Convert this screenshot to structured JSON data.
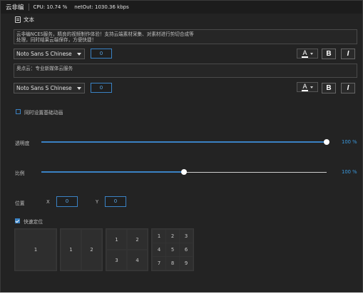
{
  "topbar": {
    "app_name": "云非编",
    "cpu": "CPU: 10.74 %",
    "net": "netOut: 1030.36 kbps"
  },
  "section": {
    "title": "文本",
    "icon": "doc-icon"
  },
  "text1": {
    "content": "云非编NCES服务，精良的视频制作体验！支持云端素材采集、对素材进行剪切合成等\n处理，同时结果云端保存，方便快捷！",
    "font": "Noto Sans S Chinese",
    "size": "0",
    "color_letter": "A",
    "bold_label": "B",
    "italic_label": "I"
  },
  "text2": {
    "content": "奥点云：专业新媒体云服务",
    "font": "Noto Sans S Chinese",
    "size": "0",
    "color_letter": "A",
    "bold_label": "B",
    "italic_label": "I"
  },
  "sync_anim": {
    "label": "同时设置基础动画",
    "checked": false
  },
  "opacity": {
    "label": "透明度",
    "value_text": "100 %",
    "value": 1.0
  },
  "scale": {
    "label": "比例",
    "value_text": "100 %",
    "value": 0.5
  },
  "position": {
    "label": "位置",
    "x_label": "X",
    "x_value": "0",
    "y_label": "Y",
    "y_value": "0"
  },
  "quick_pos": {
    "label": "快速定位",
    "checked": true
  },
  "layouts": [
    {
      "cells": [
        "1"
      ]
    },
    {
      "cells": [
        "1",
        "2"
      ]
    },
    {
      "cells": [
        "1",
        "2",
        "3",
        "4"
      ]
    },
    {
      "cells": [
        "1",
        "2",
        "3",
        "4",
        "5",
        "6",
        "7",
        "8",
        "9"
      ]
    }
  ],
  "colors": {
    "accent": "#3a82c4",
    "percent": "#3a9ae0",
    "background": "#232323"
  }
}
